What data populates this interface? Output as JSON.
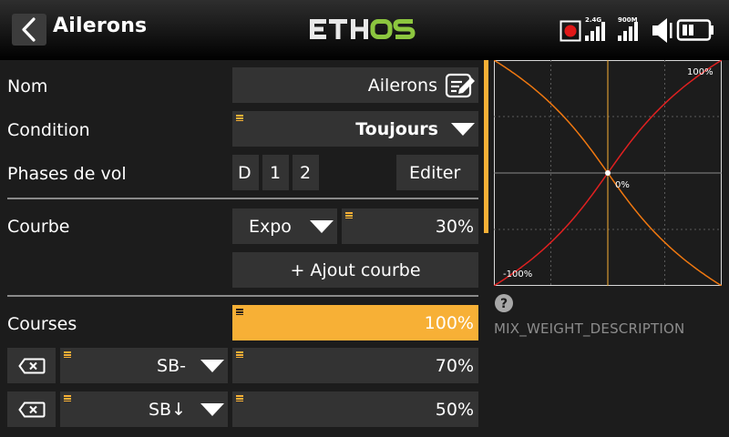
{
  "header": {
    "title": "Ailerons",
    "logo_text": "ETHOS",
    "status": {
      "rx_label": "2.4G",
      "rx2_label": "900M"
    }
  },
  "form": {
    "name": {
      "label": "Nom",
      "value": "Ailerons"
    },
    "condition": {
      "label": "Condition",
      "value": "Toujours"
    },
    "flight_modes": {
      "label": "Phases de vol",
      "modes": [
        "D",
        "1",
        "2"
      ],
      "edit_label": "Editer"
    },
    "curve": {
      "label": "Courbe",
      "type": "Expo",
      "value": "30%",
      "add_label": "+ Ajout courbe"
    },
    "rates": {
      "label": "Courses",
      "value": "100%",
      "rows": [
        {
          "switch": "SB-",
          "value": "70%"
        },
        {
          "switch": "SB↓",
          "value": "50%"
        }
      ]
    }
  },
  "chart": {
    "top_label": "100%",
    "center_label": "0%",
    "bottom_label": "-100%"
  },
  "chart_data": {
    "type": "line",
    "expo": 30,
    "x_range": [
      -100,
      100
    ],
    "y_range": [
      -100,
      100
    ],
    "grid": true,
    "series": [
      {
        "color": "#e02020"
      },
      {
        "color": "#f07810"
      }
    ]
  },
  "help": {
    "description": "MIX_WEIGHT_DESCRIPTION"
  },
  "colors": {
    "accent": "#f7b036",
    "logo_green": "#8cc63f",
    "record": "#e01818"
  }
}
